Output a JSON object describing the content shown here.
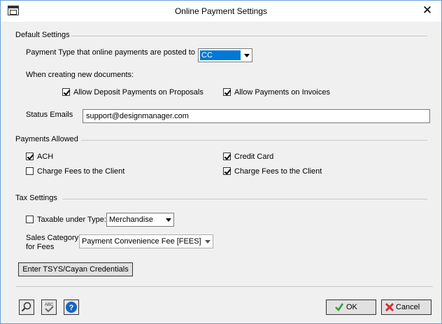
{
  "window": {
    "title": "Online Payment Settings"
  },
  "default_settings": {
    "section_label": "Default Settings",
    "payment_type_label": "Payment Type that online payments are posted to",
    "payment_type_value": "CC",
    "new_docs_label": "When creating new documents:",
    "allow_deposit_label": "Allow Deposit Payments on Proposals",
    "allow_deposit_checked": true,
    "allow_invoices_label": "Allow Payments on Invoices",
    "allow_invoices_checked": true,
    "status_emails_label": "Status Emails",
    "status_emails_value": "support@designmanager.com"
  },
  "payments_allowed": {
    "section_label": "Payments Allowed",
    "ach_label": "ACH",
    "ach_checked": true,
    "credit_card_label": "Credit Card",
    "credit_card_checked": true,
    "ach_fees_label": "Charge Fees to the Client",
    "ach_fees_checked": false,
    "cc_fees_label": "Charge Fees to the Client",
    "cc_fees_checked": true
  },
  "tax_settings": {
    "section_label": "Tax Settings",
    "taxable_label": "Taxable under Type:",
    "taxable_checked": false,
    "taxable_type_value": "Merchandise",
    "sales_category_label_line1": "Sales Category",
    "sales_category_label_line2": "for Fees",
    "sales_category_value": "Payment Convenience Fee [FEES]"
  },
  "credentials_button_label": "Enter TSYS/Cayan Credentials",
  "footer": {
    "ok_label": "OK",
    "cancel_label": "Cancel",
    "colors": {
      "ok_check": "#2e9c3a",
      "cancel_x": "#d32f2f",
      "help_blue": "#1565c0",
      "selection": "#0078d7"
    }
  }
}
